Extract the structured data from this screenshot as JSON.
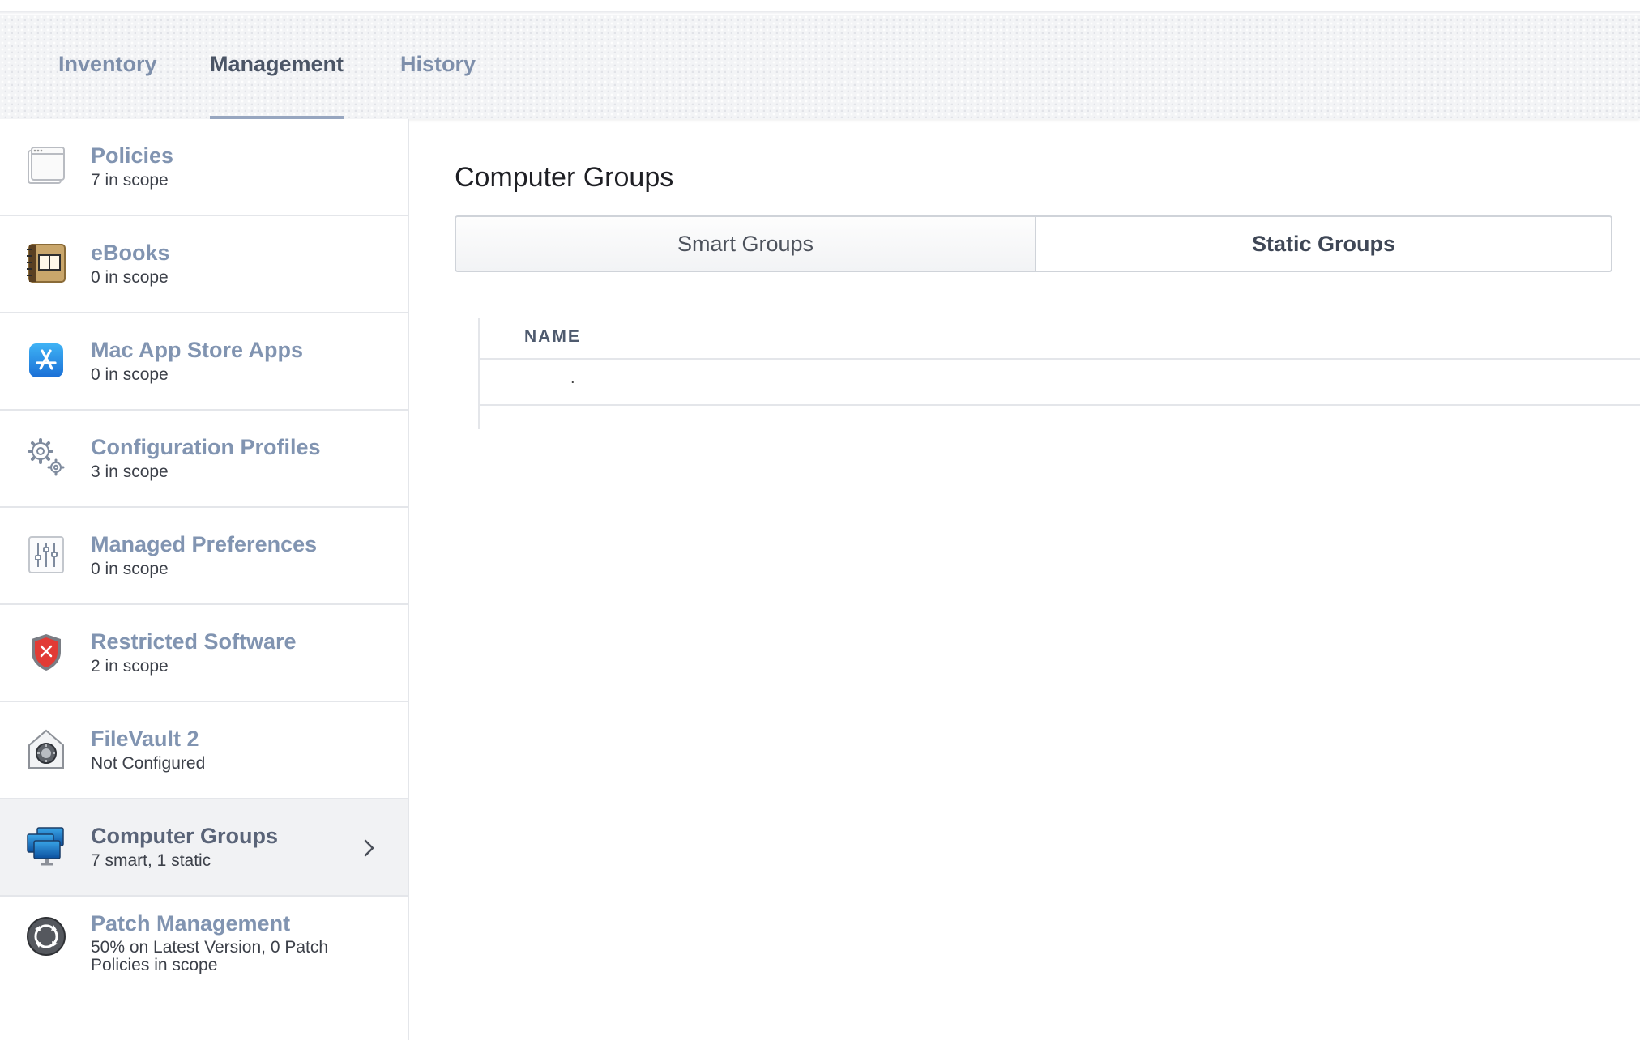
{
  "tabs": [
    {
      "label": "Inventory"
    },
    {
      "label": "Management"
    },
    {
      "label": "History"
    }
  ],
  "active_tab": "Management",
  "sidebar": {
    "items": [
      {
        "label": "Policies",
        "sub": "7 in scope",
        "icon": "policies-window-icon"
      },
      {
        "label": "eBooks",
        "sub": "0 in scope",
        "icon": "ebook-icon"
      },
      {
        "label": "Mac App Store Apps",
        "sub": "0 in scope",
        "icon": "app-store-icon"
      },
      {
        "label": "Configuration Profiles",
        "sub": "3 in scope",
        "icon": "gears-icon"
      },
      {
        "label": "Managed Preferences",
        "sub": "0 in scope",
        "icon": "sliders-icon"
      },
      {
        "label": "Restricted Software",
        "sub": "2 in scope",
        "icon": "shield-x-icon"
      },
      {
        "label": "FileVault 2",
        "sub": "Not Configured",
        "icon": "filevault-vault-icon"
      },
      {
        "label": "Computer Groups",
        "sub": "7 smart, 1 static",
        "icon": "computer-group-icon"
      },
      {
        "label": "Patch Management",
        "sub": "50% on Latest Version, 0 Patch Policies in scope",
        "icon": "patch-cycle-icon"
      }
    ],
    "selected": "Computer Groups"
  },
  "main": {
    "title": "Computer Groups",
    "segments": [
      {
        "label": "Smart Groups"
      },
      {
        "label": "Static Groups"
      }
    ],
    "active_segment": "Static Groups",
    "table": {
      "header": "NAME",
      "rows": [
        "."
      ]
    }
  },
  "colors": {
    "tab_inactive": "#7e8fab",
    "tab_active": "#4b5566",
    "sidebar_label": "#8194b1",
    "selected_row_bg": "#f1f2f4"
  }
}
